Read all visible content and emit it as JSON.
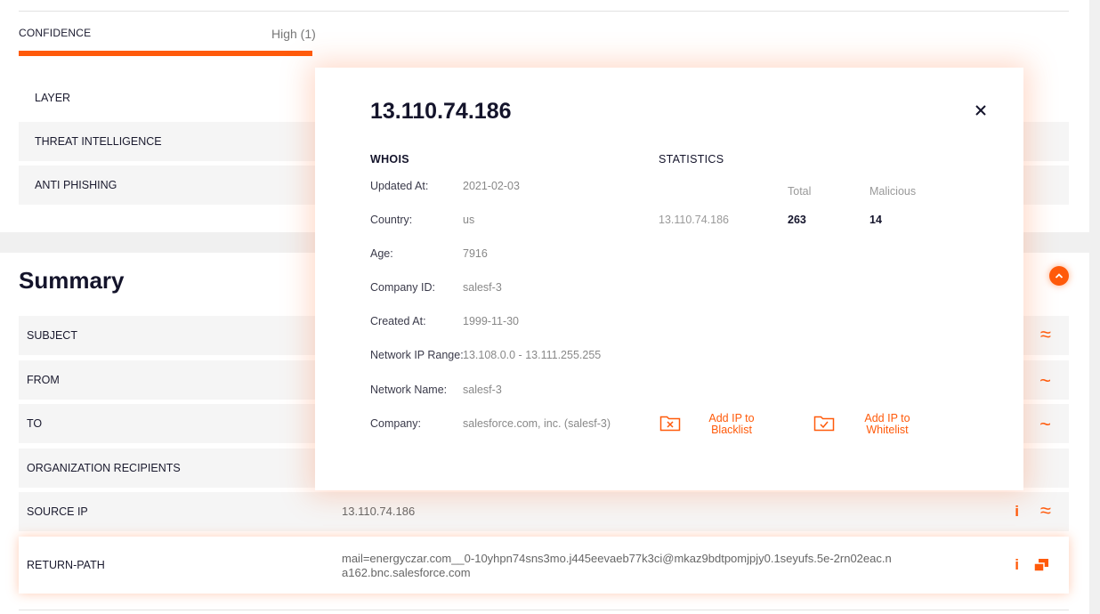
{
  "confidence": {
    "label": "CONFIDENCE",
    "value": "High (1)",
    "accent": "#ff5a0a"
  },
  "layers": [
    {
      "label": "LAYER"
    },
    {
      "label": "THREAT INTELLIGENCE"
    },
    {
      "label": "ANTI PHISHING"
    }
  ],
  "summary": {
    "title": "Summary",
    "rows": {
      "subject": {
        "label": "SUBJECT"
      },
      "from": {
        "label": "FROM"
      },
      "to": {
        "label": "TO"
      },
      "org_recipients": {
        "label": "ORGANIZATION RECIPIENTS"
      },
      "source_ip": {
        "label": "SOURCE IP",
        "value": "13.110.74.186"
      },
      "return_path": {
        "label": "RETURN-PATH",
        "value": "mail=energyczar.com__0-10yhpn74sns3mo.j445eevaeb77k3ci@mkaz9bdtpomjpjy0.1seyufs.5e-2rn02eac.na162.bnc.salesforce.com"
      }
    }
  },
  "modal": {
    "title": "13.110.74.186",
    "close_glyph": "×",
    "whois": {
      "heading": "WHOIS",
      "fields": [
        {
          "label": "Updated At:",
          "value": "2021-02-03"
        },
        {
          "label": "Country:",
          "value": "us"
        },
        {
          "label": "Age:",
          "value": "7916"
        },
        {
          "label": "Company ID:",
          "value": "salesf-3"
        },
        {
          "label": "Created At:",
          "value": "1999-11-30"
        },
        {
          "label": "Network IP Range:",
          "value": "13.108.0.0 - 13.111.255.255"
        },
        {
          "label": "Network Name:",
          "value": "salesf-3"
        },
        {
          "label": "Company:",
          "value": "salesforce.com, inc. (salesf-3)"
        }
      ]
    },
    "statistics": {
      "heading": "STATISTICS",
      "col_total": "Total",
      "col_malicious": "Malicious",
      "ip": "13.110.74.186",
      "total": "263",
      "malicious": "14"
    },
    "actions": {
      "blacklist": "Add IP to Blacklist",
      "whitelist": "Add IP to Whitelist"
    }
  },
  "icons": {
    "approx": "≈",
    "tilde": "~",
    "info": "i",
    "chevron_up": "^"
  }
}
